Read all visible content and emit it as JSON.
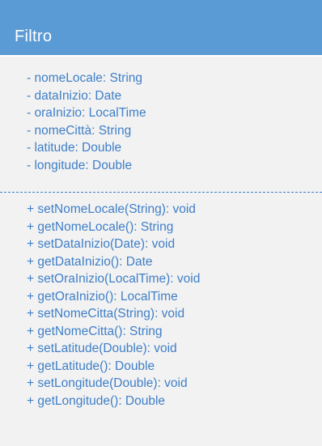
{
  "class": {
    "name": "Filtro",
    "header_color": "#5b9bd5",
    "body_color": "#f2f2f2",
    "text_color": "#3f7fc7"
  },
  "attributes": [
    "- nomeLocale: String",
    "- dataInizio: Date",
    "- oraInizio: LocalTime",
    "- nomeCittà: String",
    "- latitude: Double",
    "- longitude: Double"
  ],
  "methods": [
    "+ setNomeLocale(String): void",
    "+ getNomeLocale(): String",
    "+ setDataInizio(Date): void",
    "+ getDataInizio(): Date",
    "+ setOraInizio(LocalTime): void",
    "+ getOraInizio(): LocalTime",
    "+ setNomeCitta(String): void",
    "+ getNomeCitta(): String",
    "+ setLatitude(Double): void",
    "+ getLatitude(): Double",
    "+ setLongitude(Double): void",
    "+ getLongitude(): Double"
  ]
}
